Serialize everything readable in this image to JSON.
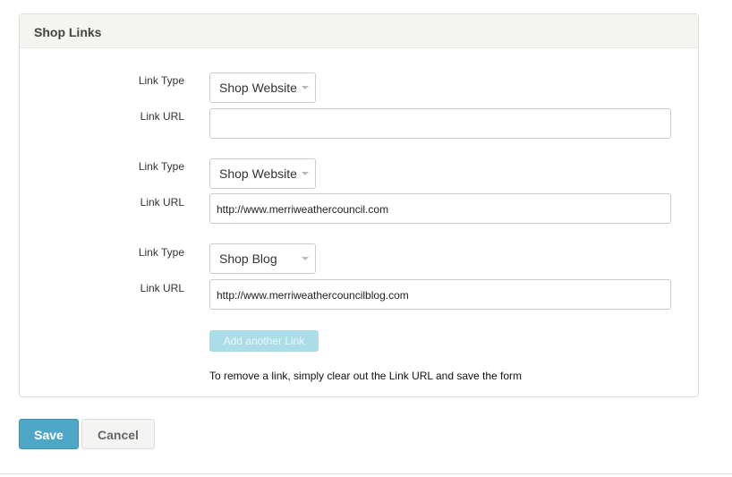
{
  "panel": {
    "title": "Shop Links"
  },
  "links": [
    {
      "type_label": "Link Type",
      "type": "Shop Website",
      "url_label": "Link URL",
      "url": ""
    },
    {
      "type_label": "Link Type",
      "type": "Shop Website",
      "url_label": "Link URL",
      "url": "http://www.merriweathercouncil.com"
    },
    {
      "type_label": "Link Type",
      "type": "Shop Blog",
      "url_label": "Link URL",
      "url": "http://www.merriweathercouncilblog.com"
    }
  ],
  "add_label": "Add another Link",
  "note": "To remove a link, simply clear out the Link URL and save the form",
  "actions": {
    "save": "Save",
    "cancel": "Cancel"
  }
}
